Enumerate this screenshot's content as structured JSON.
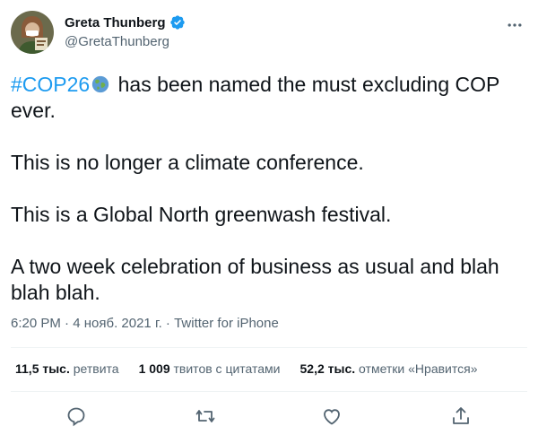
{
  "author": {
    "name": "Greta Thunberg",
    "handle": "@GretaThunberg",
    "verified": true
  },
  "tweet": {
    "hashtag": "#COP26",
    "emoji": "globe-emoji",
    "line1_rest": " has been named the must excluding COP ever.",
    "para2": "This is no longer a climate conference.",
    "para3": "This is a Global North greenwash festival.",
    "para4": "A two week celebration of business as usual and blah blah blah."
  },
  "meta": {
    "time": "6:20 PM",
    "separator": " · ",
    "date": "4 нояб. 2021 г.",
    "source": "Twitter for iPhone"
  },
  "stats": {
    "retweets_count": "11,5 тыс.",
    "retweets_label": "ретвита",
    "quotes_count": "1 009",
    "quotes_label": "твитов с цитатами",
    "likes_count": "52,2 тыс.",
    "likes_label": "отметки «Нравится»"
  },
  "icons": {
    "reply": "reply-icon",
    "retweet": "retweet-icon",
    "like": "like-icon",
    "share": "share-icon",
    "more": "more-icon"
  },
  "colors": {
    "link": "#1d9bf0",
    "text": "#0f1419",
    "secondary": "#536471",
    "verified": "#1d9bf0"
  }
}
